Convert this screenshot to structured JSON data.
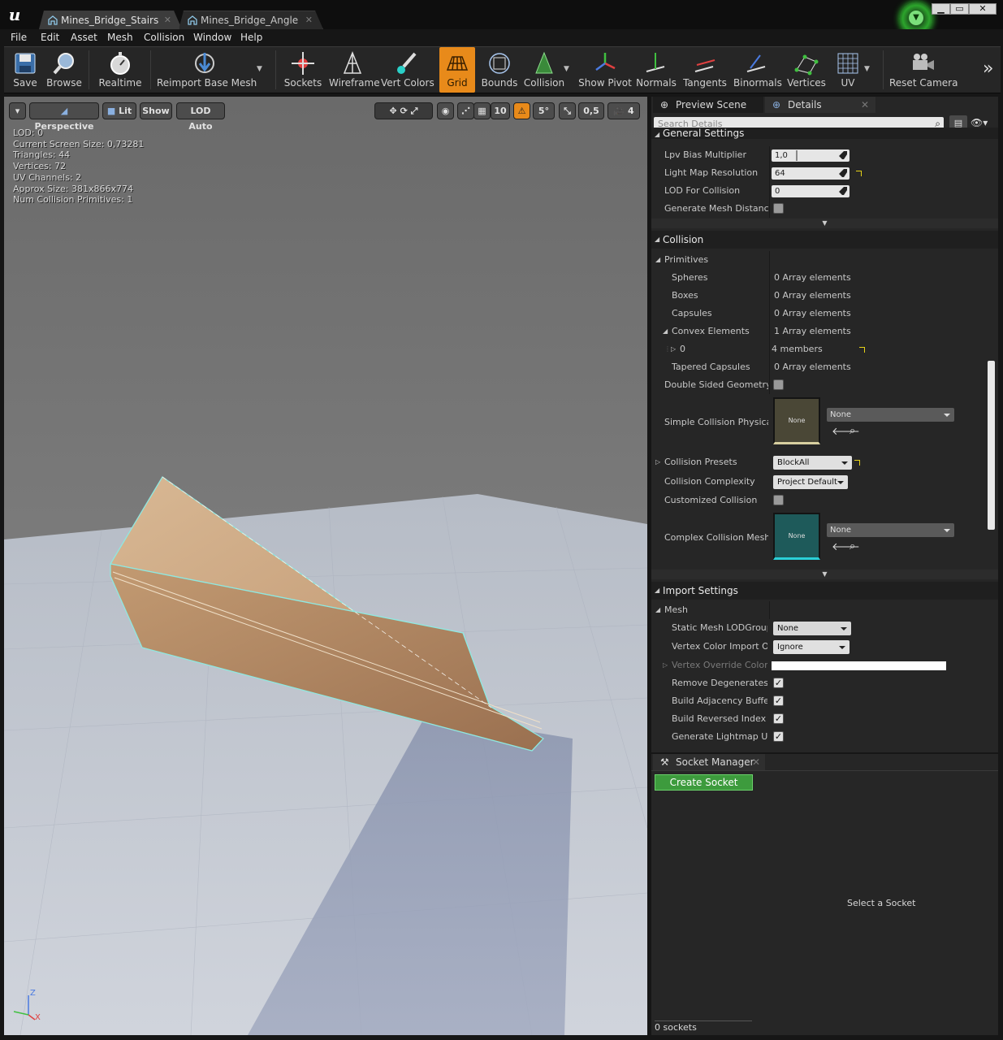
{
  "tabs": [
    {
      "label": "Mines_Bridge_Stairs",
      "active": true
    },
    {
      "label": "Mines_Bridge_Angle",
      "active": false
    }
  ],
  "window_controls": {
    "minimize": "▁",
    "maximize": "▭",
    "close": "✕"
  },
  "menu": [
    "File",
    "Edit",
    "Asset",
    "Mesh",
    "Collision",
    "Window",
    "Help"
  ],
  "toolbar": {
    "save": "Save",
    "browse": "Browse",
    "realtime": "Realtime",
    "reimport": "Reimport Base Mesh",
    "sockets": "Sockets",
    "wireframe": "Wireframe",
    "vert_colors": "Vert Colors",
    "grid": "Grid",
    "bounds": "Bounds",
    "collision": "Collision",
    "show_pivot": "Show Pivot",
    "normals": "Normals",
    "tangents": "Tangents",
    "binormals": "Binormals",
    "vertices": "Vertices",
    "uv": "UV",
    "reset_camera": "Reset Camera",
    "more": "»"
  },
  "viewport": {
    "perspective": "Perspective",
    "lit": "Lit",
    "show": "Show",
    "lod_auto": "LOD Auto",
    "grid_size": "10",
    "rot_snap": "5°",
    "scale_snap": "0,5",
    "cam_speed": "4",
    "stats": [
      "LOD:  0",
      "Current Screen Size:  0,73281",
      "Triangles:  44",
      "Vertices:  72",
      "UV Channels:  2",
      "Approx Size: 381x866x774",
      "Num Collision Primitives:  1"
    ],
    "axis": {
      "z": "Z",
      "x": "X"
    }
  },
  "details": {
    "tab_preview": "Preview Scene Sett",
    "tab_details": "Details",
    "search_placeholder": "Search Details",
    "general_settings": "General Settings",
    "lpv_bias": {
      "label": "Lpv Bias Multiplier",
      "value": "1,0"
    },
    "light_map_res": {
      "label": "Light Map Resolution",
      "value": "64"
    },
    "lod_collision": {
      "label": "LOD For Collision",
      "value": "0"
    },
    "gen_distance": {
      "label": "Generate Mesh Distance Fie"
    },
    "collision": "Collision",
    "primitives": "Primitives",
    "spheres": {
      "label": "Spheres",
      "value": "0 Array elements"
    },
    "boxes": {
      "label": "Boxes",
      "value": "0 Array elements"
    },
    "capsules": {
      "label": "Capsules",
      "value": "0 Array elements"
    },
    "convex": {
      "label": "Convex Elements",
      "value": "1 Array elements"
    },
    "convex0": {
      "label": "0",
      "value": "4 members"
    },
    "tapered": {
      "label": "Tapered Capsules",
      "value": "0 Array elements"
    },
    "double_sided": {
      "label": "Double Sided Geometry"
    },
    "simple_phys": {
      "label": "Simple Collision Physical M",
      "thumb": "None",
      "asset": "None"
    },
    "presets": {
      "label": "Collision Presets",
      "value": "BlockAll"
    },
    "complexity": {
      "label": "Collision Complexity",
      "value": "Project Default"
    },
    "customized": {
      "label": "Customized Collision"
    },
    "complex_mesh": {
      "label": "Complex Collision Mesh",
      "thumb": "None",
      "asset": "None"
    },
    "import_settings": "Import Settings",
    "mesh": "Mesh",
    "lodgroup": {
      "label": "Static Mesh LODGroup",
      "value": "None"
    },
    "vcolor_import": {
      "label": "Vertex Color Import Optio",
      "value": "Ignore"
    },
    "vcolor_override": {
      "label": "Vertex Override Color"
    },
    "remove_degen": {
      "label": "Remove Degenerates"
    },
    "adjacency": {
      "label": "Build Adjacency Buffer"
    },
    "reversed_index": {
      "label": "Build Reversed Index Buff"
    },
    "gen_lightmap": {
      "label": "Generate Lightmap UVs"
    }
  },
  "socket_manager": {
    "title": "Socket Manager",
    "create": "Create Socket",
    "select_hint": "Select a Socket",
    "count": "0 sockets"
  },
  "colors": {
    "accent": "#e88a1a",
    "create_green": "#3d9b3d",
    "collision_edge": "#8fe8e0"
  }
}
